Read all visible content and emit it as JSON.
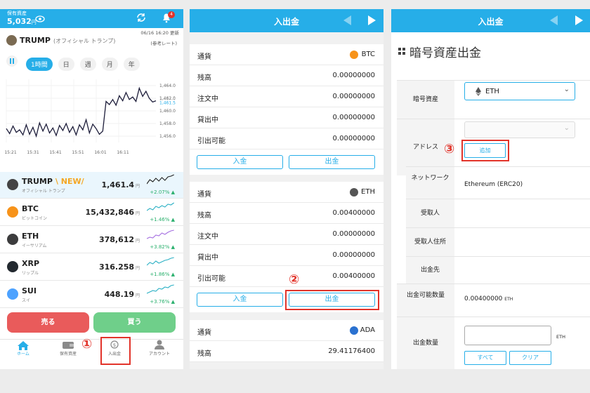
{
  "screen1": {
    "asset_label": "保有資産",
    "asset_amount": "5,032",
    "asset_unit": "円",
    "notification_count": "4",
    "featured_symbol": "TRUMP",
    "featured_name": "(オフィシャル トランプ)",
    "timestamp": "06/16 16:20 更新",
    "reference_rate": "(参考レート)",
    "timeframes": [
      "1時間",
      "日",
      "週",
      "月",
      "年"
    ],
    "chart_data": {
      "type": "line",
      "x": [
        "15:21",
        "15:31",
        "15:41",
        "15:51",
        "16:01",
        "16:11"
      ],
      "xlabel": "",
      "ylabel": "",
      "ylim": [
        1455.0,
        1465.0
      ],
      "y_ticks": [
        "1,464.0",
        "1,462.0",
        "1,460.0",
        "1,458.0",
        "1,456.0"
      ],
      "current_value_labels": [
        "1,461.5",
        "1,467.0"
      ],
      "values": [
        1457.2,
        1456.4,
        1457.6,
        1456.6,
        1457.0,
        1456.2,
        1457.8,
        1456.3,
        1457.4,
        1456.0,
        1458.1,
        1456.8,
        1457.9,
        1456.5,
        1457.3,
        1456.1,
        1457.7,
        1456.9,
        1458.0,
        1456.6,
        1457.5,
        1456.2,
        1457.8,
        1457.0,
        1458.6,
        1456.5,
        1457.9,
        1457.2,
        1456.3,
        1456.8,
        1461.5,
        1461.0,
        1461.8,
        1460.9,
        1462.4,
        1461.6,
        1462.9,
        1461.8,
        1462.2,
        1461.5,
        1463.6,
        1462.3,
        1463.1,
        1462.0,
        1461.4,
        1461.6
      ]
    },
    "coins": [
      {
        "symbol": "TRUMP",
        "badge": "NEW",
        "sub": "オフィシャル トランプ",
        "price": "1,461.4",
        "change": "+2.07% ▲",
        "color": "#444444"
      },
      {
        "symbol": "BTC",
        "sub": "ビットコイン",
        "price": "15,432,846",
        "change": "+1.46% ▲",
        "color": "#f7931a"
      },
      {
        "symbol": "ETH",
        "sub": "イーサリアム",
        "price": "378,612",
        "change": "+3.82% ▲",
        "color": "#3c3c3d"
      },
      {
        "symbol": "XRP",
        "sub": "リップル",
        "price": "316.258",
        "change": "+1.86% ▲",
        "color": "#23292f"
      },
      {
        "symbol": "SUI",
        "sub": "スイ",
        "price": "448.19",
        "change": "+3.76% ▲",
        "color": "#4da2ff"
      }
    ],
    "price_unit": "円",
    "sell_label": "売る",
    "buy_label": "買う",
    "nav": [
      "ホーム",
      "保有資産",
      "入出金",
      "アカウント"
    ],
    "marker": "①"
  },
  "screen2": {
    "title": "入出金",
    "cards": [
      {
        "currency_label": "通貨",
        "currency": "BTC",
        "rows": [
          {
            "k": "残高",
            "v": "0.00000000"
          },
          {
            "k": "注文中",
            "v": "0.00000000"
          },
          {
            "k": "貸出中",
            "v": "0.00000000"
          },
          {
            "k": "引出可能",
            "v": "0.00000000"
          }
        ]
      },
      {
        "currency_label": "通貨",
        "currency": "ETH",
        "rows": [
          {
            "k": "残高",
            "v": "0.00400000"
          },
          {
            "k": "注文中",
            "v": "0.00000000"
          },
          {
            "k": "貸出中",
            "v": "0.00000000"
          },
          {
            "k": "引出可能",
            "v": "0.00400000"
          }
        ]
      },
      {
        "currency_label": "通貨",
        "currency": "ADA",
        "rows": [
          {
            "k": "残高",
            "v": "29.41176400"
          }
        ]
      }
    ],
    "deposit_label": "入金",
    "withdraw_label": "出金",
    "marker": "②"
  },
  "screen3": {
    "title": "入出金",
    "heading": "暗号資産出金",
    "crypto_label": "暗号資産",
    "crypto_value": "ETH",
    "address_label": "アドレス",
    "add_label": "追加",
    "network_label": "ネットワーク",
    "network_value": "Ethereum (ERC20)",
    "recipient_label": "受取人",
    "recipient_address_label": "受取人住所",
    "destination_label": "出金先",
    "available_label": "出金可能数量",
    "available_value": "0.00400000",
    "available_unit": "ETH",
    "amount_label": "出金数量",
    "amount_unit": "ETH",
    "all_label": "すべて",
    "clear_label": "クリア",
    "marker": "③"
  },
  "colors": {
    "accent": "#26aee8",
    "sell": "#e95b5b",
    "buy": "#6fcf8a",
    "highlight": "#e2332a",
    "up": "#2ab06d"
  }
}
